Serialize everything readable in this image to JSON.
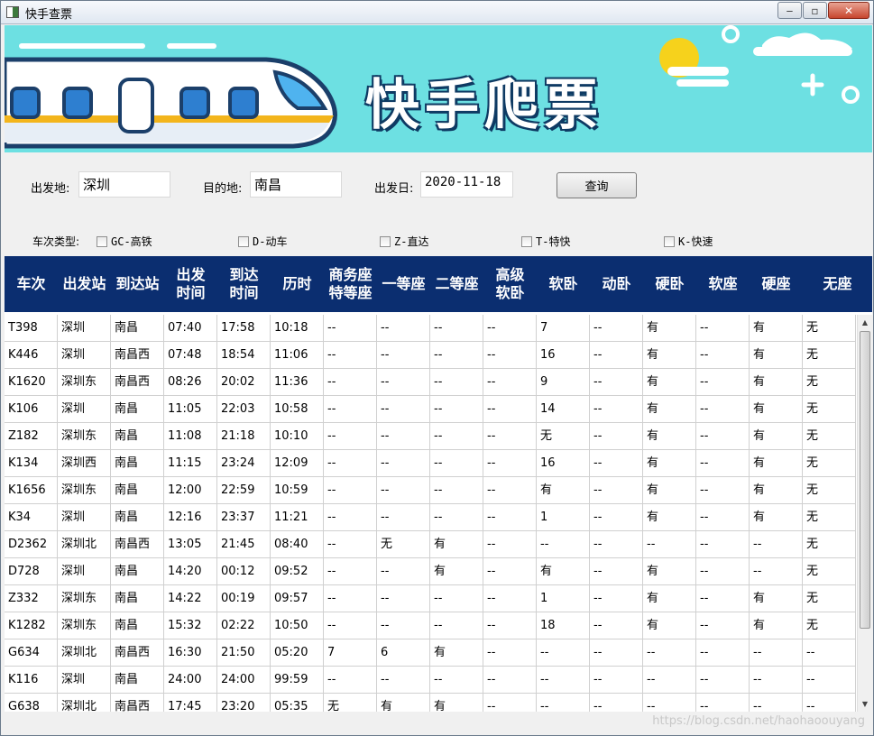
{
  "window": {
    "title": "快手查票",
    "minimize": "‒",
    "maximize": "▫",
    "close": "✕"
  },
  "banner": {
    "title": "快手爬票"
  },
  "form": {
    "from_label": "出发地:",
    "from_value": "深圳",
    "to_label": "目的地:",
    "to_value": "南昌",
    "date_label": "出发日:",
    "date_value": "2020-11-18",
    "query_button": "查询"
  },
  "filters": {
    "label": "车次类型:",
    "options": [
      {
        "label": "GC-高铁",
        "checked": false
      },
      {
        "label": "D-动车",
        "checked": false
      },
      {
        "label": "Z-直达",
        "checked": false
      },
      {
        "label": "T-特快",
        "checked": false
      },
      {
        "label": "K-快速",
        "checked": false
      }
    ]
  },
  "table": {
    "columns": [
      "车次",
      "出发站",
      "到达站",
      "出发\n时间",
      "到达\n时间",
      "历时",
      "商务座\n特等座",
      "一等座",
      "二等座",
      "高级\n软卧",
      "软卧",
      "动卧",
      "硬卧",
      "软座",
      "硬座",
      "无座"
    ],
    "rows": [
      [
        "T398",
        "深圳",
        "南昌",
        "07:40",
        "17:58",
        "10:18",
        "--",
        "--",
        "--",
        "--",
        "7",
        "--",
        "有",
        "--",
        "有",
        "无"
      ],
      [
        "K446",
        "深圳",
        "南昌西",
        "07:48",
        "18:54",
        "11:06",
        "--",
        "--",
        "--",
        "--",
        "16",
        "--",
        "有",
        "--",
        "有",
        "无"
      ],
      [
        "K1620",
        "深圳东",
        "南昌西",
        "08:26",
        "20:02",
        "11:36",
        "--",
        "--",
        "--",
        "--",
        "9",
        "--",
        "有",
        "--",
        "有",
        "无"
      ],
      [
        "K106",
        "深圳",
        "南昌",
        "11:05",
        "22:03",
        "10:58",
        "--",
        "--",
        "--",
        "--",
        "14",
        "--",
        "有",
        "--",
        "有",
        "无"
      ],
      [
        "Z182",
        "深圳东",
        "南昌",
        "11:08",
        "21:18",
        "10:10",
        "--",
        "--",
        "--",
        "--",
        "无",
        "--",
        "有",
        "--",
        "有",
        "无"
      ],
      [
        "K134",
        "深圳西",
        "南昌",
        "11:15",
        "23:24",
        "12:09",
        "--",
        "--",
        "--",
        "--",
        "16",
        "--",
        "有",
        "--",
        "有",
        "无"
      ],
      [
        "K1656",
        "深圳东",
        "南昌",
        "12:00",
        "22:59",
        "10:59",
        "--",
        "--",
        "--",
        "--",
        "有",
        "--",
        "有",
        "--",
        "有",
        "无"
      ],
      [
        "K34",
        "深圳",
        "南昌",
        "12:16",
        "23:37",
        "11:21",
        "--",
        "--",
        "--",
        "--",
        "1",
        "--",
        "有",
        "--",
        "有",
        "无"
      ],
      [
        "D2362",
        "深圳北",
        "南昌西",
        "13:05",
        "21:45",
        "08:40",
        "--",
        "无",
        "有",
        "--",
        "--",
        "--",
        "--",
        "--",
        "--",
        "无"
      ],
      [
        "D728",
        "深圳",
        "南昌",
        "14:20",
        "00:12",
        "09:52",
        "--",
        "--",
        "有",
        "--",
        "有",
        "--",
        "有",
        "--",
        "--",
        "无"
      ],
      [
        "Z332",
        "深圳东",
        "南昌",
        "14:22",
        "00:19",
        "09:57",
        "--",
        "--",
        "--",
        "--",
        "1",
        "--",
        "有",
        "--",
        "有",
        "无"
      ],
      [
        "K1282",
        "深圳东",
        "南昌",
        "15:32",
        "02:22",
        "10:50",
        "--",
        "--",
        "--",
        "--",
        "18",
        "--",
        "有",
        "--",
        "有",
        "无"
      ],
      [
        "G634",
        "深圳北",
        "南昌西",
        "16:30",
        "21:50",
        "05:20",
        "7",
        "6",
        "有",
        "--",
        "--",
        "--",
        "--",
        "--",
        "--",
        "--"
      ],
      [
        "K116",
        "深圳",
        "南昌",
        "24:00",
        "24:00",
        "99:59",
        "--",
        "--",
        "--",
        "--",
        "--",
        "--",
        "--",
        "--",
        "--",
        "--"
      ],
      [
        "G638",
        "深圳北",
        "南昌西",
        "17:45",
        "23:20",
        "05:35",
        "无",
        "有",
        "有",
        "--",
        "--",
        "--",
        "--",
        "--",
        "--",
        "--"
      ]
    ]
  },
  "status": {
    "watermark": "https://blog.csdn.net/haohaoouyang"
  },
  "colors": {
    "banner_bg": "#6de0e2",
    "header_bg": "#0b2e70",
    "header_text": "#ffffff"
  }
}
